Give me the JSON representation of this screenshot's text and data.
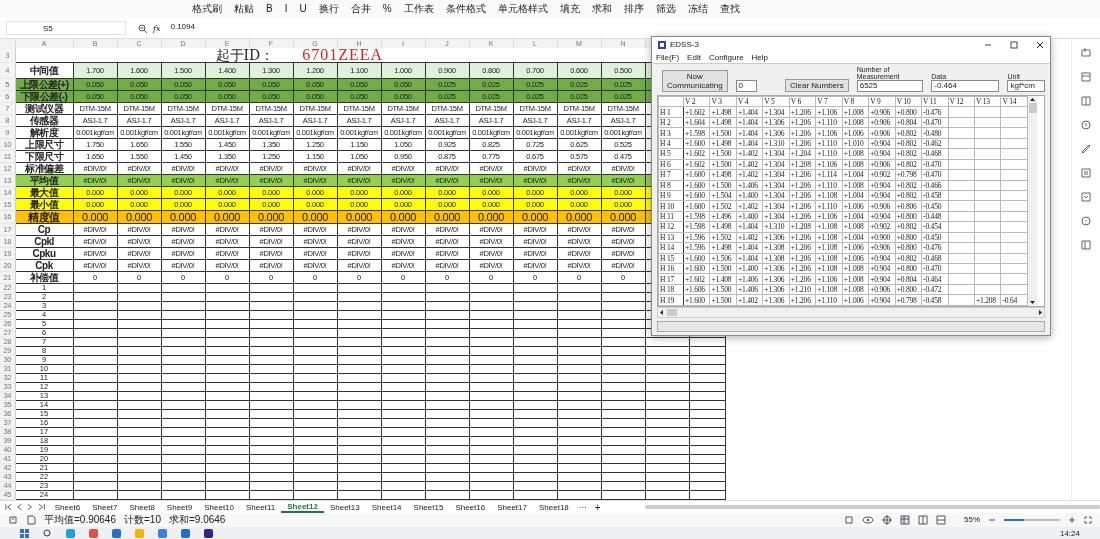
{
  "ribbon": [
    "格式刷",
    "粘贴",
    "B",
    "I",
    "U",
    "换行",
    "合并",
    "%",
    "工作表",
    "条件格式",
    "单元格样式",
    "填充",
    "求和",
    "排序",
    "筛选",
    "冻结",
    "查找"
  ],
  "formula_bar": {
    "cell": "S5",
    "fx": "fx",
    "value": "0.1094"
  },
  "sheet": {
    "columns": [
      "A",
      "B",
      "C",
      "D",
      "E",
      "F",
      "G",
      "H",
      "I",
      "J",
      "K",
      "L",
      "M",
      "N"
    ],
    "title": {
      "number": "3",
      "label": "起于ID：",
      "value": "6701ZEEA"
    },
    "rows": [
      {
        "number": "4",
        "label": "中间值",
        "kind": "light",
        "values": [
          "1.700",
          "1.600",
          "1.500",
          "1.400",
          "1.300",
          "1.200",
          "1.100",
          "1.000",
          "0.900",
          "0.800",
          "0.700",
          "0.600",
          "0.500"
        ]
      },
      {
        "number": "5",
        "label": "上限公差(+)",
        "kind": "green",
        "values": [
          "0.050",
          "0.050",
          "0.050",
          "0.050",
          "0.050",
          "0.050",
          "0.050",
          "0.050",
          "0.025",
          "0.025",
          "0.025",
          "0.025",
          "0.025"
        ]
      },
      {
        "number": "6",
        "label": "下限公差(-)",
        "kind": "green",
        "values": [
          "0.050",
          "0.050",
          "0.050",
          "0.050",
          "0.050",
          "0.050",
          "0.050",
          "0.050",
          "0.025",
          "0.025",
          "0.025",
          "0.025",
          "0.025"
        ]
      },
      {
        "number": "7",
        "label": "测试仪器",
        "kind": "plain",
        "values": [
          "DTM-15M",
          "DTM-15M",
          "DTM-15M",
          "DTM-15M",
          "DTM-15M",
          "DTM-15M",
          "DTM-15M",
          "DTM-15M",
          "DTM-15M",
          "DTM-15M",
          "DTM-15M",
          "DTM-15M",
          "DTM-15M"
        ]
      },
      {
        "number": "8",
        "label": "传感器",
        "kind": "plain",
        "values": [
          "ASJ-1.7",
          "ASJ-1.7",
          "ASJ-1.7",
          "ASJ-1.7",
          "ASJ-1.7",
          "ASJ-1.7",
          "ASJ-1.7",
          "ASJ-1.7",
          "ASJ-1.7",
          "ASJ-1.7",
          "ASJ-1.7",
          "ASJ-1.7",
          "ASJ-1.7"
        ]
      },
      {
        "number": "9",
        "label": "解析度",
        "kind": "plain",
        "values": [
          "0.001kgf/cm",
          "0.001kgf/cm",
          "0.001kgf/cm",
          "0.001kgf/cm",
          "0.001kgf/cm",
          "0.001kgf/cm",
          "0.001kgf/cm",
          "0.001kgf/cm",
          "0.001kgf/cm",
          "0.001kgf/cm",
          "0.001kgf/cm",
          "0.001kgf/cm",
          "0.001kgf/cm"
        ]
      },
      {
        "number": "10",
        "label": "上限尺寸",
        "kind": "plain",
        "values": [
          "1.750",
          "1.650",
          "1.550",
          "1.450",
          "1.350",
          "1.250",
          "1.150",
          "1.050",
          "0.925",
          "0.825",
          "0.725",
          "0.625",
          "0.525"
        ]
      },
      {
        "number": "11",
        "label": "下限尺寸",
        "kind": "plain",
        "values": [
          "1.650",
          "1.550",
          "1.450",
          "1.350",
          "1.250",
          "1.150",
          "1.050",
          "0.950",
          "0.875",
          "0.775",
          "0.675",
          "0.575",
          "0.475"
        ]
      },
      {
        "number": "12",
        "label": "标准偏差",
        "kind": "plain",
        "values": [
          "#DIV/0!",
          "#DIV/0!",
          "#DIV/0!",
          "#DIV/0!",
          "#DIV/0!",
          "#DIV/0!",
          "#DIV/0!",
          "#DIV/0!",
          "#DIV/0!",
          "#DIV/0!",
          "#DIV/0!",
          "#DIV/0!",
          "#DIV/0!"
        ]
      },
      {
        "number": "13",
        "label": "平均值",
        "kind": "avg",
        "values": [
          "#DIV/0!",
          "#DIV/0!",
          "#DIV/0!",
          "#DIV/0!",
          "#DIV/0!",
          "#DIV/0!",
          "#DIV/0!",
          "#DIV/0!",
          "#DIV/0!",
          "#DIV/0!",
          "#DIV/0!",
          "#DIV/0!",
          "#DIV/0!"
        ]
      },
      {
        "number": "14",
        "label": "最大值",
        "kind": "yellow",
        "values": [
          "0.000",
          "0.000",
          "0.000",
          "0.000",
          "0.000",
          "0.000",
          "0.000",
          "0.000",
          "0.000",
          "0.000",
          "0.000",
          "0.000",
          "0.000"
        ]
      },
      {
        "number": "15",
        "label": "最小值",
        "kind": "yellow",
        "values": [
          "0.000",
          "0.000",
          "0.000",
          "0.000",
          "0.000",
          "0.000",
          "0.000",
          "0.000",
          "0.000",
          "0.000",
          "0.000",
          "0.000",
          "0.000"
        ]
      },
      {
        "number": "16",
        "label": "精度值",
        "kind": "orange",
        "values": [
          "0.000",
          "0.000",
          "0.000",
          "0.000",
          "0.000",
          "0.000",
          "0.000",
          "0.000",
          "0.000",
          "0.000",
          "0.000",
          "0.000",
          "0.000"
        ]
      },
      {
        "number": "17",
        "label": "Cp",
        "kind": "plain",
        "values": [
          "#DIV/0!",
          "#DIV/0!",
          "#DIV/0!",
          "#DIV/0!",
          "#DIV/0!",
          "#DIV/0!",
          "#DIV/0!",
          "#DIV/0!",
          "#DIV/0!",
          "#DIV/0!",
          "#DIV/0!",
          "#DIV/0!",
          "#DIV/0!"
        ]
      },
      {
        "number": "18",
        "label": "Cpkl",
        "kind": "plain",
        "values": [
          "#DIV/0!",
          "#DIV/0!",
          "#DIV/0!",
          "#DIV/0!",
          "#DIV/0!",
          "#DIV/0!",
          "#DIV/0!",
          "#DIV/0!",
          "#DIV/0!",
          "#DIV/0!",
          "#DIV/0!",
          "#DIV/0!",
          "#DIV/0!"
        ]
      },
      {
        "number": "19",
        "label": "Cpku",
        "kind": "plain",
        "values": [
          "#DIV/0!",
          "#DIV/0!",
          "#DIV/0!",
          "#DIV/0!",
          "#DIV/0!",
          "#DIV/0!",
          "#DIV/0!",
          "#DIV/0!",
          "#DIV/0!",
          "#DIV/0!",
          "#DIV/0!",
          "#DIV/0!",
          "#DIV/0!"
        ]
      },
      {
        "number": "20",
        "label": "Cpk",
        "kind": "plain",
        "values": [
          "#DIV/0!",
          "#DIV/0!",
          "#DIV/0!",
          "#DIV/0!",
          "#DIV/0!",
          "#DIV/0!",
          "#DIV/0!",
          "#DIV/0!",
          "#DIV/0!",
          "#DIV/0!",
          "#DIV/0!",
          "#DIV/0!",
          "#DIV/0!"
        ]
      },
      {
        "number": "21",
        "label": "补偿值",
        "kind": "plain",
        "values": [
          "0",
          "0",
          "0",
          "0",
          "0",
          "0",
          "0",
          "0",
          "0",
          "0",
          "0",
          "0",
          "0"
        ]
      }
    ],
    "index_rows": [
      {
        "number": "22",
        "label": "1"
      },
      {
        "number": "23",
        "label": "2"
      },
      {
        "number": "24",
        "label": "3"
      },
      {
        "number": "25",
        "label": "4"
      },
      {
        "number": "26",
        "label": "5"
      },
      {
        "number": "27",
        "label": "6"
      },
      {
        "number": "28",
        "label": "7"
      },
      {
        "number": "29",
        "label": "8"
      },
      {
        "number": "30",
        "label": "9"
      },
      {
        "number": "31",
        "label": "10"
      },
      {
        "number": "32",
        "label": "11"
      },
      {
        "number": "33",
        "label": "12"
      },
      {
        "number": "34",
        "label": "13"
      },
      {
        "number": "35",
        "label": "14"
      },
      {
        "number": "36",
        "label": "15"
      },
      {
        "number": "37",
        "label": "16"
      },
      {
        "number": "38",
        "label": "17"
      },
      {
        "number": "39",
        "label": "18"
      },
      {
        "number": "40",
        "label": "19"
      },
      {
        "number": "41",
        "label": "20"
      },
      {
        "number": "42",
        "label": "21"
      },
      {
        "number": "43",
        "label": "22"
      },
      {
        "number": "44",
        "label": "23"
      },
      {
        "number": "45",
        "label": "24"
      }
    ]
  },
  "sheet_tabs": [
    {
      "label": "Sheet6",
      "selected": false
    },
    {
      "label": "Sheet7",
      "selected": false
    },
    {
      "label": "Sheet8",
      "selected": false
    },
    {
      "label": "Sheet9",
      "selected": false
    },
    {
      "label": "Sheet10",
      "selected": false
    },
    {
      "label": "Sheet11",
      "selected": false
    },
    {
      "label": "Sheet12",
      "selected": true
    },
    {
      "label": "Sheet13",
      "selected": false
    },
    {
      "label": "Sheet14",
      "selected": false
    },
    {
      "label": "Sheet15",
      "selected": false
    },
    {
      "label": "Sheet16",
      "selected": false
    },
    {
      "label": "Sheet17",
      "selected": false
    },
    {
      "label": "Sheet18",
      "selected": false
    }
  ],
  "sheet_more": "···",
  "sheet_add": "+",
  "status_bar": {
    "average": "平均值=0.90646",
    "count": "计数=10",
    "sum": "求和=9.0646",
    "zoom": "55%",
    "zoom_slider": {
      "level": 0.35
    }
  },
  "taskbar": {
    "time": "14:24"
  },
  "edss": {
    "title": "EDSS-3",
    "menu": [
      "File(F)",
      "Edit",
      "Configure",
      "Help"
    ],
    "communicating_button": "Now Communicating",
    "counter": "0",
    "clear_button": "Clear Numbers",
    "measurement": {
      "label": "Number of Measurement",
      "value": "6525"
    },
    "data": {
      "label": "Data",
      "value": "-0.464"
    },
    "unit": {
      "label": "Unit",
      "value": "kgf*cm"
    },
    "columns": [
      "V 2",
      "V 3",
      "V 4",
      "V 5",
      "V 6",
      "V 7",
      "V 8",
      "V 9",
      "V 10",
      "V 11",
      "V 12",
      "V 13",
      "V 14"
    ],
    "rows": [
      {
        "label": "H 1",
        "values": [
          "+1.602",
          "+1.498",
          "+1.404",
          "+1.304",
          "+1.206",
          "+1.106",
          "+1.008",
          "+0.906",
          "+0.800",
          "-0.476"
        ]
      },
      {
        "label": "H 2",
        "values": [
          "+1.604",
          "+1.498",
          "+1.404",
          "+1.306",
          "+1.206",
          "+1.110",
          "+1.008",
          "+0.906",
          "+0.804",
          "-0.470"
        ]
      },
      {
        "label": "H 3",
        "values": [
          "+1.598",
          "+1.500",
          "+1.404",
          "+1.306",
          "+1.206",
          "+1.106",
          "+1.006",
          "+0.906",
          "+0.802",
          "-0.480"
        ]
      },
      {
        "label": "H 4",
        "values": [
          "+1.600",
          "+1.498",
          "+1.404",
          "+1.310",
          "+1.206",
          "+1.110",
          "+1.010",
          "+0.904",
          "+0.802",
          "-0.462"
        ]
      },
      {
        "label": "H 5",
        "values": [
          "+1.602",
          "+1.500",
          "+1.402",
          "+1.304",
          "+1.204",
          "+1.110",
          "+1.008",
          "+0.904",
          "+0.802",
          "-0.468"
        ]
      },
      {
        "label": "H 6",
        "values": [
          "+1.602",
          "+1.500",
          "+1.402",
          "+1.304",
          "+1.208",
          "+1.106",
          "+1.008",
          "+0.906",
          "+0.802",
          "-0.470"
        ]
      },
      {
        "label": "H 7",
        "values": [
          "+1.600",
          "+1.498",
          "+1.402",
          "+1.304",
          "+1.206",
          "+1.114",
          "+1.004",
          "+0.902",
          "+0.798",
          "-0.470"
        ]
      },
      {
        "label": "H 8",
        "values": [
          "+1.600",
          "+1.500",
          "+1.406",
          "+1.304",
          "+1.206",
          "+1.110",
          "+1.008",
          "+0.904",
          "+0.802",
          "-0.466"
        ]
      },
      {
        "label": "H 9",
        "values": [
          "+1.600",
          "+1.504",
          "+1.400",
          "+1.304",
          "+1.206",
          "+1.108",
          "+1.004",
          "+0.904",
          "+0.802",
          "-0.458"
        ]
      },
      {
        "label": "H 10",
        "values": [
          "+1.600",
          "+1.502",
          "+1.402",
          "+1.304",
          "+1.206",
          "+1.110",
          "+1.006",
          "+0.906",
          "+0.806",
          "-0.450"
        ]
      },
      {
        "label": "H 11",
        "values": [
          "+1.598",
          "+1.496",
          "+1.400",
          "+1.304",
          "+1.206",
          "+1.106",
          "+1.004",
          "+0.904",
          "+0.800",
          "-0.448"
        ]
      },
      {
        "label": "H 12",
        "values": [
          "+1.598",
          "+1.498",
          "+1.404",
          "+1.310",
          "+1.208",
          "+1.108",
          "+1.008",
          "+0.902",
          "+0.802",
          "-0.454"
        ]
      },
      {
        "label": "H 13",
        "values": [
          "+1.596",
          "+1.502",
          "+1.402",
          "+1.306",
          "+1.206",
          "+1.108",
          "+1.004",
          "+0.900",
          "+0.800",
          "-0.450"
        ]
      },
      {
        "label": "H 14",
        "values": [
          "+1.596",
          "+1.498",
          "+1.404",
          "+1.308",
          "+1.206",
          "+1.108",
          "+1.006",
          "+0.906",
          "+0.800",
          "-0.476"
        ]
      },
      {
        "label": "H 15",
        "values": [
          "+1.600",
          "+1.506",
          "+1.404",
          "+1.308",
          "+1.206",
          "+1.108",
          "+1.006",
          "+0.904",
          "+0.802",
          "-0.468"
        ]
      },
      {
        "label": "H 16",
        "values": [
          "+1.600",
          "+1.500",
          "+1.400",
          "+1.306",
          "+1.206",
          "+1.108",
          "+1.008",
          "+0.904",
          "+0.800",
          "-0.470"
        ]
      },
      {
        "label": "H 17",
        "values": [
          "+1.602",
          "+1.408",
          "+1.406",
          "+1.306",
          "+1.206",
          "+1.106",
          "+1.008",
          "+0.904",
          "+0.804",
          "-0.464"
        ]
      },
      {
        "label": "H 18",
        "values": [
          "+1.606",
          "+1.500",
          "+1.406",
          "+1.306",
          "+1.210",
          "+1.108",
          "+1.008",
          "+0.906",
          "+0.800",
          "-0.472"
        ]
      },
      {
        "label": "H 19",
        "values": [
          "+1.600",
          "+1.500",
          "+1.402",
          "+1.306",
          "+1.206",
          "+1.110",
          "+1.006",
          "+0.904",
          "+0.798",
          "-0.458"
        ],
        "trailing": [
          "+1.208",
          "-0.64"
        ]
      }
    ]
  }
}
